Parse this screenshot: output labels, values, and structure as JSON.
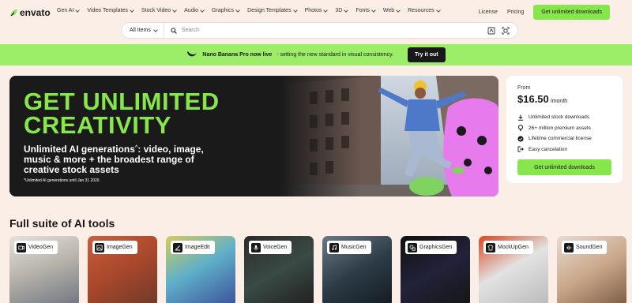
{
  "brand": {
    "name": "envato"
  },
  "nav": {
    "items": [
      {
        "label": "Gen AI"
      },
      {
        "label": "Video Templates"
      },
      {
        "label": "Stock Video"
      },
      {
        "label": "Audio"
      },
      {
        "label": "Graphics"
      },
      {
        "label": "Design Templates"
      },
      {
        "label": "Photos"
      },
      {
        "label": "3D"
      },
      {
        "label": "Fonts"
      },
      {
        "label": "Web"
      },
      {
        "label": "Resources"
      }
    ],
    "license": "License",
    "pricing": "Pricing",
    "cta": "Get unlimited downloads"
  },
  "search": {
    "scope": "All Items",
    "placeholder": "Search"
  },
  "banner": {
    "title": "Nano Banana Pro now live",
    "text": "- setting the new standard in visual consistency.",
    "button": "Try it out"
  },
  "hero": {
    "headline_line1": "GET UNLIMITED",
    "headline_line2": "CREATIVITY",
    "sub_part1": "Unlimited AI generations",
    "sub_part2": ": video, image, music & more + the broadest range of creative stock assets",
    "footnote": "*Unlimited AI generations until Jan 31 2026"
  },
  "pricing_card": {
    "from": "From",
    "price": "$16.50",
    "per": "/month",
    "features": [
      {
        "icon": "download-icon",
        "label": "Unlimited stock downloads"
      },
      {
        "icon": "bulb-icon",
        "label": "26+ million premium assets"
      },
      {
        "icon": "badge-check-icon",
        "label": "Lifetime commercial license"
      },
      {
        "icon": "logout-icon",
        "label": "Easy cancelation"
      }
    ],
    "cta": "Get unlimited downloads"
  },
  "ai_tools": {
    "title": "Full suite of AI tools",
    "items": [
      {
        "label": "VideoGen",
        "icon": "video-icon"
      },
      {
        "label": "ImageGen",
        "icon": "image-icon"
      },
      {
        "label": "ImageEdit",
        "icon": "edit-icon"
      },
      {
        "label": "VoiceGen",
        "icon": "mic-icon"
      },
      {
        "label": "MusicGen",
        "icon": "music-icon"
      },
      {
        "label": "GraphicsGen",
        "icon": "graphics-icon"
      },
      {
        "label": "MockUpGen",
        "icon": "mockup-icon"
      },
      {
        "label": "SoundGen",
        "icon": "sound-icon"
      }
    ]
  },
  "colors": {
    "accent": "#87e64b",
    "banner": "#9cee69",
    "background": "#fbeee6",
    "hero_bg": "#1a1a1a"
  }
}
